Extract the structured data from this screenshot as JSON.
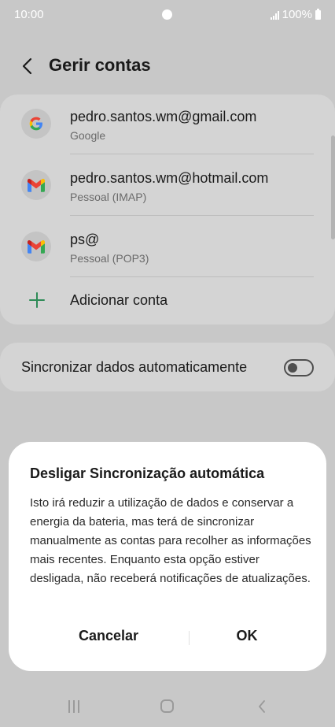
{
  "status_bar": {
    "time": "10:00",
    "battery": "100%"
  },
  "header": {
    "title": "Gerir contas"
  },
  "accounts": [
    {
      "email": "pedro.santos.wm@gmail.com",
      "type": "Google",
      "icon": "google-icon"
    },
    {
      "email": "pedro.santos.wm@hotmail.com",
      "type": "Pessoal (IMAP)",
      "icon": "gmail-icon"
    },
    {
      "email": "ps@",
      "type": "Pessoal (POP3)",
      "icon": "gmail-icon"
    }
  ],
  "add_account": {
    "label": "Adicionar conta",
    "icon": "plus-icon"
  },
  "sync": {
    "label": "Sincronizar dados automaticamente",
    "enabled": false
  },
  "dialog": {
    "title": "Desligar Sincronização automática",
    "message": "Isto irá reduzir a utilização de dados e conservar a energia da bateria, mas terá de sincronizar manualmente as contas para recolher as informações mais recentes. Enquanto esta opção estiver desligada, não receberá notificações de atualizações.",
    "cancel_label": "Cancelar",
    "ok_label": "OK"
  },
  "colors": {
    "scrim_background": "#c8c8c8",
    "card_background": "#d4d4d4",
    "dialog_background": "#ffffff",
    "add_icon_green": "#2e8b57",
    "google_blue": "#4285F4",
    "google_red": "#EA4335",
    "google_yellow": "#FBBC05",
    "google_green": "#34A853"
  }
}
